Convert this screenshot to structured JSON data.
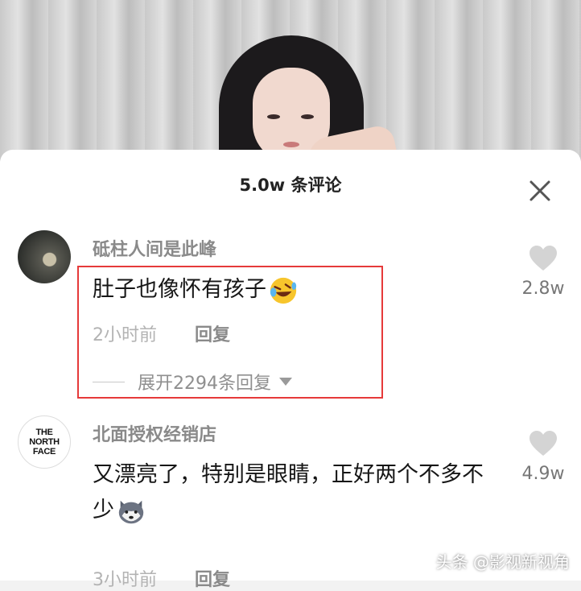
{
  "header": {
    "title": "5.0w 条评论"
  },
  "comments": [
    {
      "username": "砥柱人间是此峰",
      "text": "肚子也像怀有孩子",
      "emoji": "rofl-emoji",
      "time": "2小时前",
      "reply_label": "回复",
      "likes": "2.8w",
      "expand_label": "展开2294条回复"
    },
    {
      "username": "北面授权经销店",
      "avatar_text": [
        "THE",
        "NORTH",
        "FACE"
      ],
      "text": "又漂亮了，特别是眼睛，正好两个不多不少",
      "emoji": "husky-emoji",
      "time": "3小时前",
      "reply_label": "回复",
      "likes": "4.9w"
    }
  ],
  "watermark": "头条 @影视新视角",
  "colors": {
    "highlight": "#e63a3a",
    "username": "#8a8a8a",
    "meta": "#b3b3b3"
  },
  "icons": {
    "close": "close-icon",
    "like": "heart-icon"
  }
}
